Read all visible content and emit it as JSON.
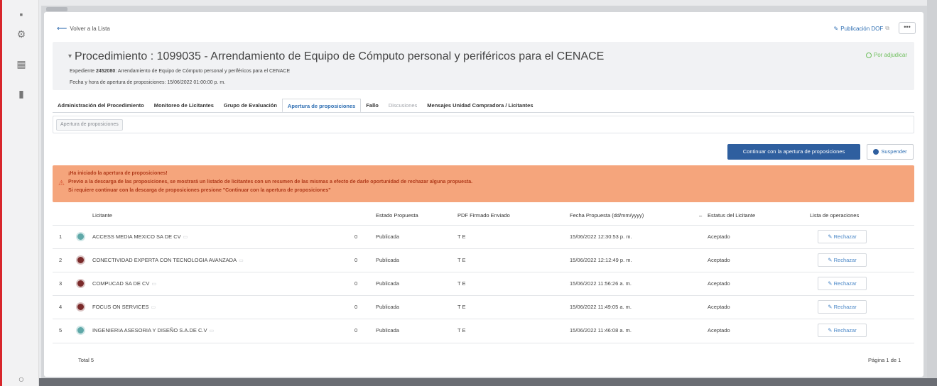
{
  "header": {
    "back_label": "Volver a la Lista",
    "dof_label": "Publicación DOF",
    "more_label": "•••",
    "title": "Procedimiento : 1099035 - Arrendamiento de Equipo de Cómputo personal y periféricos para el CENACE",
    "status": "Por adjudicar",
    "expediente_label": "Expediente",
    "expediente_number": "2452080",
    "expediente_text": ": Arrendamiento de Equipo de Cómputo personal y periféricos para el CENACE",
    "apertura_text": "Fecha y hora de apertura de proposiciones: 15/06/2022 01:00:00 p. m."
  },
  "tabs": [
    {
      "label": "Administración del Procedimiento"
    },
    {
      "label": "Monitoreo de Licitantes"
    },
    {
      "label": "Grupo de Evaluación"
    },
    {
      "label": "Apertura de proposiciones"
    },
    {
      "label": "Fallo"
    },
    {
      "label": "Discusiones"
    },
    {
      "label": "Mensajes Unidad Compradora / Licitantes"
    }
  ],
  "subtab": "Apertura de proposiciones",
  "actions": {
    "continue_label": "Continuar con la apertura de proposiciones",
    "suspend_label": "Suspender"
  },
  "alert": {
    "line1": "¡Ha iniciado la apertura de proposiciones!",
    "line2": "Previo a la descarga de las proposiciones, se mostrará un listado de licitantes con un resumen de las mismas a efecto de darle oportunidad de rechazar alguna propuesta.",
    "line3": "Si requiere continuar con la descarga de proposiciones presione \"Continuar con la apertura de proposiciones\""
  },
  "table": {
    "columns": {
      "licitante": "Licitante",
      "estado": "Estado Propuesta",
      "pdf": "PDF Firmado Enviado",
      "fecha": "Fecha Propuesta (dd/mm/yyyy)",
      "estatus": "Estatus del Licitante",
      "operaciones": "Lista de operaciones"
    },
    "rows": [
      {
        "num": "1",
        "licitante": "ACCESS MEDIA MEXICO SA DE CV",
        "count": "0",
        "estado": "Publicada",
        "pdf": "T E",
        "fecha": "15/06/2022 12:30:53 p. m.",
        "estatus": "Aceptado",
        "action": "Rechazar"
      },
      {
        "num": "2",
        "licitante": "CONECTIVIDAD EXPERTA CON TECNOLOGIA AVANZADA",
        "count": "0",
        "estado": "Publicada",
        "pdf": "T E",
        "fecha": "15/06/2022 12:12:49 p. m.",
        "estatus": "Aceptado",
        "action": "Rechazar"
      },
      {
        "num": "3",
        "licitante": "COMPUCAD SA DE CV",
        "count": "0",
        "estado": "Publicada",
        "pdf": "T E",
        "fecha": "15/06/2022 11:56:26 a. m.",
        "estatus": "Aceptado",
        "action": "Rechazar"
      },
      {
        "num": "4",
        "licitante": "FOCUS ON SERVICES",
        "count": "0",
        "estado": "Publicada",
        "pdf": "T E",
        "fecha": "15/06/2022 11:49:05 a. m.",
        "estatus": "Aceptado",
        "action": "Rechazar"
      },
      {
        "num": "5",
        "licitante": "INGENIERIA ASESORIA Y DISEÑO S.A.DE C.V",
        "count": "0",
        "estado": "Publicada",
        "pdf": "T E",
        "fecha": "15/06/2022 11:46:08 a. m.",
        "estatus": "Aceptado",
        "action": "Rechazar"
      }
    ],
    "total": "Total 5",
    "pages": "Página 1 de 1"
  }
}
